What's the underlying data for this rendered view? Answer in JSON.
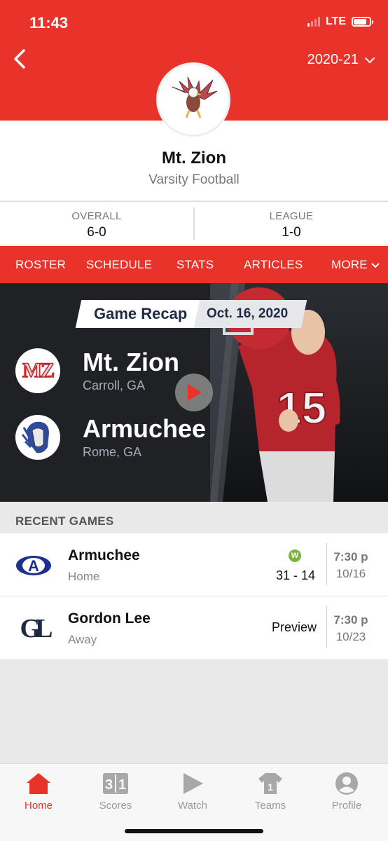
{
  "status": {
    "time": "11:43",
    "network": "LTE"
  },
  "header": {
    "season": "2020-21"
  },
  "team": {
    "name": "Mt. Zion",
    "subtitle": "Varsity Football"
  },
  "record": {
    "overall_label": "OVERALL",
    "overall_value": "6-0",
    "league_label": "LEAGUE",
    "league_value": "1-0"
  },
  "tabs": [
    "ROSTER",
    "SCHEDULE",
    "STATS",
    "ARTICLES",
    "MORE"
  ],
  "recap": {
    "title": "Game Recap",
    "date": "Oct. 16, 2020",
    "home": {
      "name": "Mt. Zion",
      "location": "Carroll, GA",
      "logo_text": "MZ"
    },
    "away": {
      "name": "Armuchee",
      "location": "Rome, GA"
    }
  },
  "recent_games": {
    "title": "RECENT GAMES",
    "games": [
      {
        "opponent": "Armuchee",
        "location": "Home",
        "result_badge": "W",
        "score": "31 - 14",
        "time": "7:30 p",
        "date": "10/16",
        "logo_text": "A"
      },
      {
        "opponent": "Gordon Lee",
        "location": "Away",
        "status": "Preview",
        "time": "7:30 p",
        "date": "10/23",
        "logo_text": "GL"
      }
    ]
  },
  "bottom_nav": [
    "Home",
    "Scores",
    "Watch",
    "Teams",
    "Profile"
  ],
  "colors": {
    "brand": "#e8322a",
    "dark": "#1f2124",
    "win": "#7cb342",
    "navy": "#1f2a44"
  }
}
